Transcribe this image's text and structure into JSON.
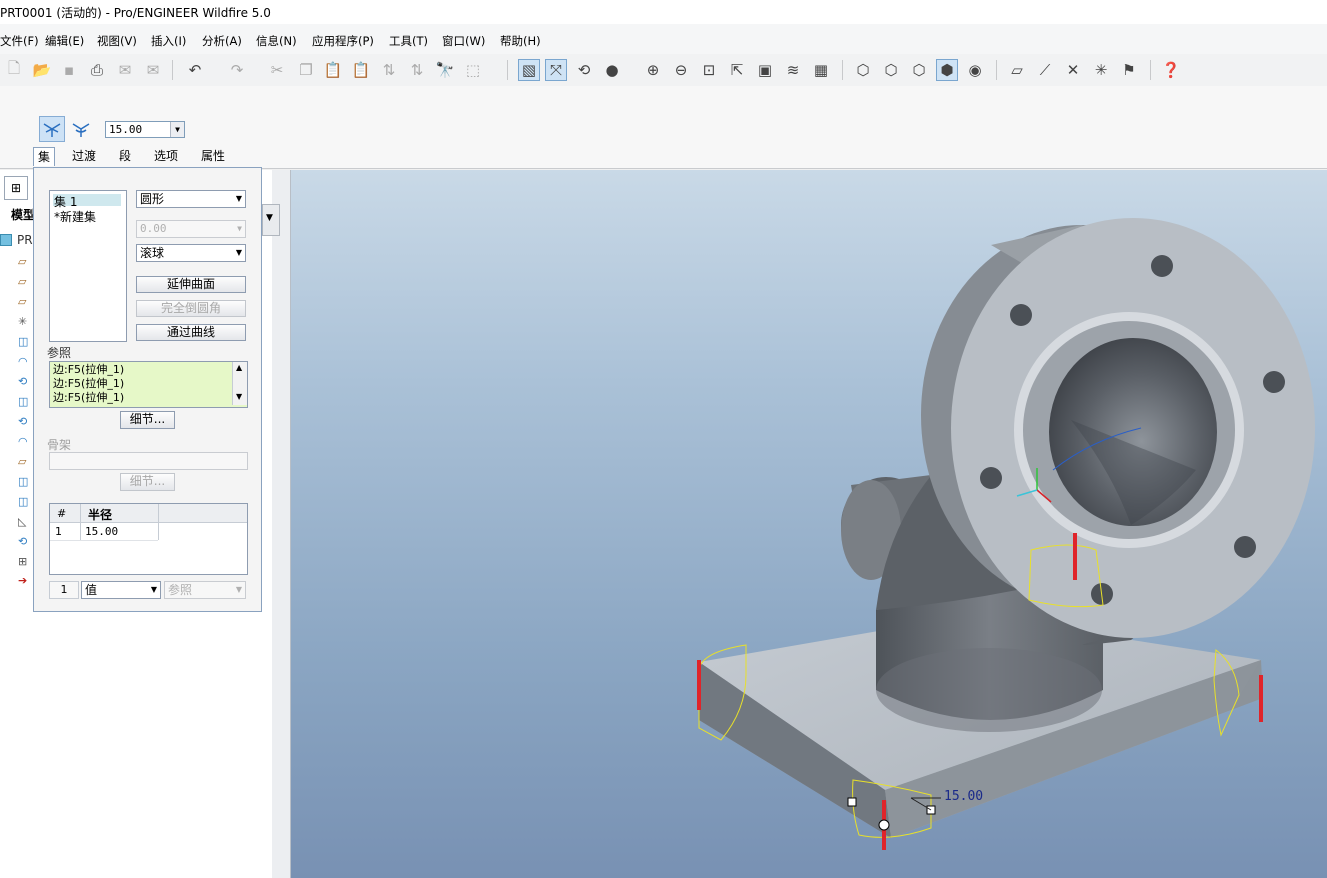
{
  "window": {
    "title": "PRT0001 (活动的) - Pro/ENGINEER Wildfire 5.0"
  },
  "menu": [
    "文件(F)",
    "编辑(E)",
    "视图(V)",
    "插入(I)",
    "分析(A)",
    "信息(N)",
    "应用程序(P)",
    "工具(T)",
    "窗口(W)",
    "帮助(H)"
  ],
  "dashboard": {
    "radius_value": "15.00",
    "tabs": [
      "集",
      "过渡",
      "段",
      "选项",
      "属性"
    ]
  },
  "sets_panel": {
    "sets": [
      "集 1",
      "*新建集"
    ],
    "shape_select": "圆形",
    "value_field": "0.00",
    "method_select": "滚球",
    "btn_extend": "延伸曲面",
    "btn_full_round": "完全倒圆角",
    "btn_through_curve": "通过曲线",
    "references_label": "参照",
    "references": [
      "边:F5(拉伸_1)",
      "边:F5(拉伸_1)",
      "边:F5(拉伸_1)"
    ],
    "details_btn": "细节...",
    "skeleton_label": "骨架",
    "details_btn_2": "细节...",
    "radius_table": {
      "headers": [
        "#",
        "半径"
      ],
      "rows": [
        [
          "1",
          "15.00"
        ]
      ]
    },
    "bottom_index": "1",
    "bottom_value_select": "值",
    "bottom_ref_select": "参照"
  },
  "tree": {
    "tab_label": "模型",
    "root": "PR"
  },
  "viewport": {
    "dimension_label": "15.00"
  }
}
